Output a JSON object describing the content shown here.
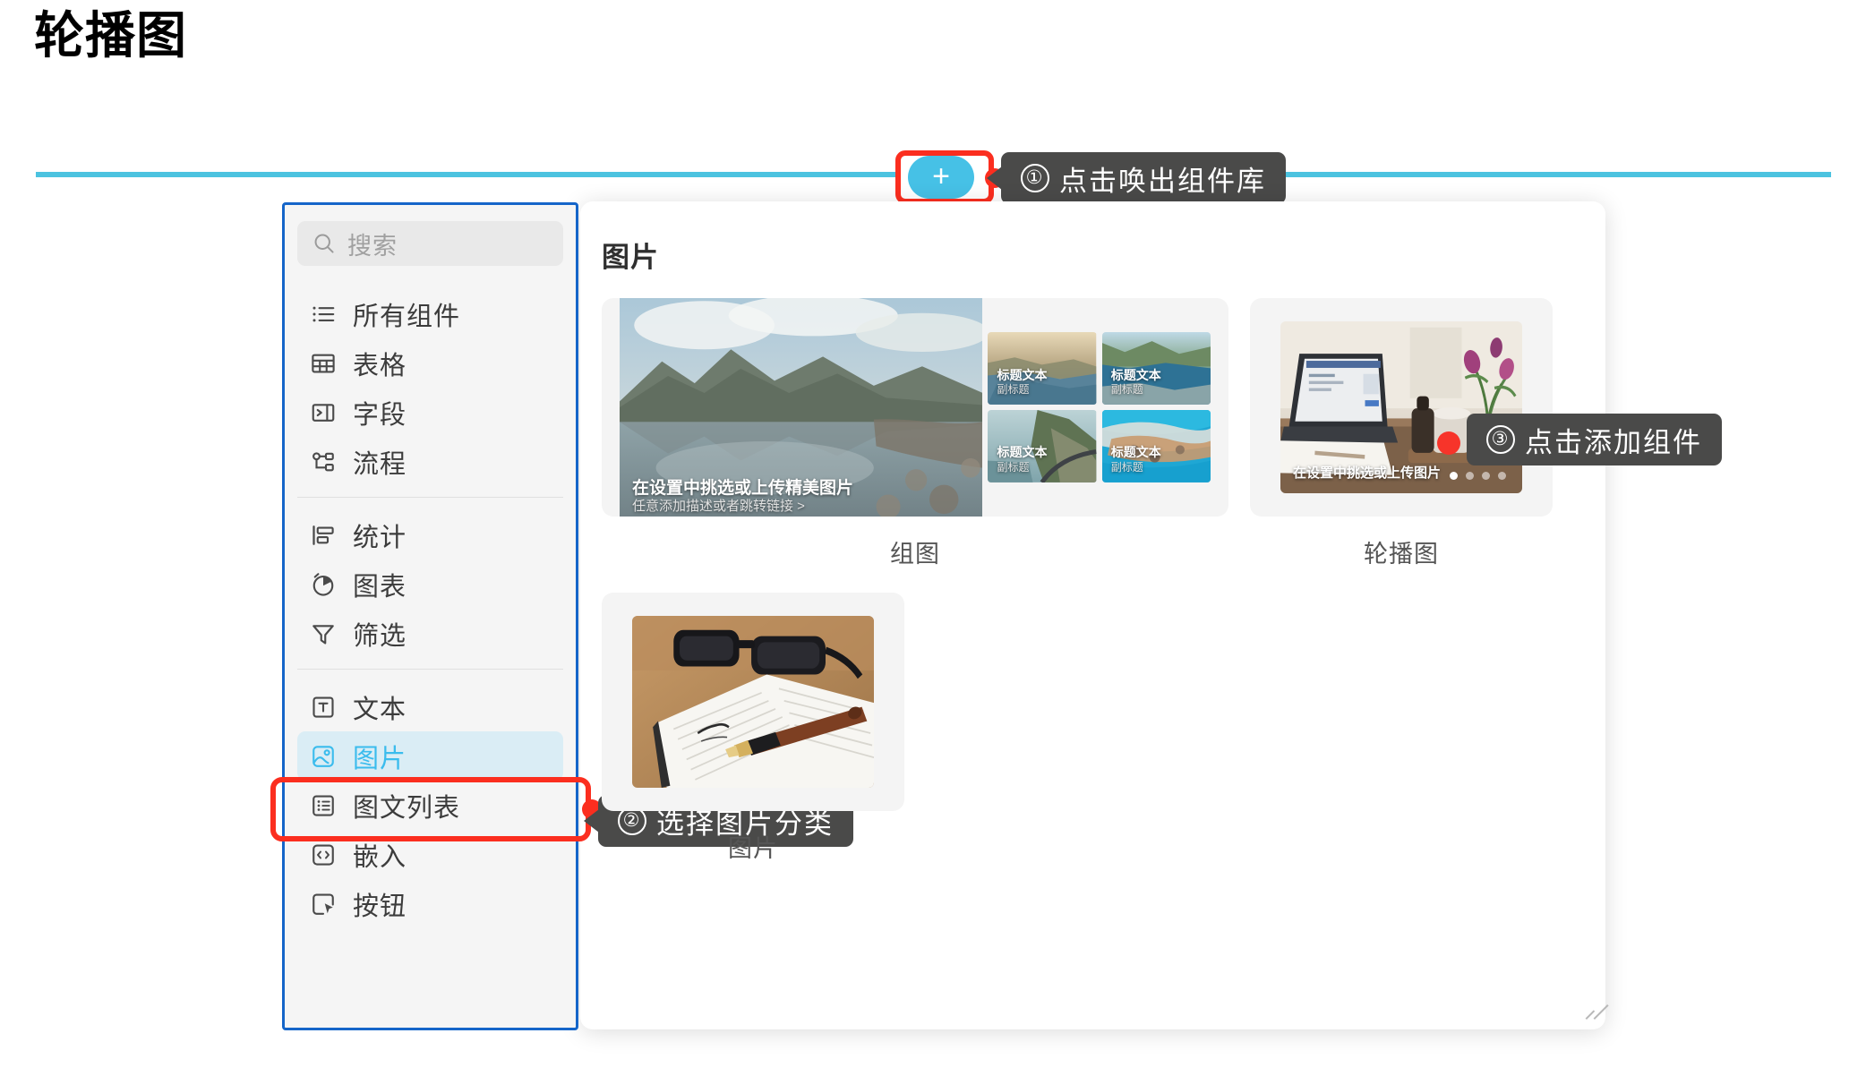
{
  "page": {
    "title": "轮播图"
  },
  "toolbar": {
    "add_button_glyph": "+"
  },
  "callouts": [
    {
      "num": "①",
      "text": "点击唤出组件库"
    },
    {
      "num": "②",
      "text": "选择图片分类"
    },
    {
      "num": "③",
      "text": "点击添加组件"
    }
  ],
  "sidebar": {
    "search": {
      "placeholder": "搜索",
      "value": ""
    },
    "groups": [
      {
        "items": [
          {
            "label": "所有组件",
            "icon": "list-icon",
            "active": false
          },
          {
            "label": "表格",
            "icon": "table-icon",
            "active": false
          },
          {
            "label": "字段",
            "icon": "field-icon",
            "active": false
          },
          {
            "label": "流程",
            "icon": "flow-icon",
            "active": false
          }
        ]
      },
      {
        "items": [
          {
            "label": "统计",
            "icon": "stats-icon",
            "active": false
          },
          {
            "label": "图表",
            "icon": "chart-pie-icon",
            "active": false
          },
          {
            "label": "筛选",
            "icon": "filter-icon",
            "active": false
          }
        ]
      },
      {
        "items": [
          {
            "label": "文本",
            "icon": "text-icon",
            "active": false
          },
          {
            "label": "图片",
            "icon": "image-icon",
            "active": true
          },
          {
            "label": "图文列表",
            "icon": "image-text-list-icon",
            "active": false
          },
          {
            "label": "嵌入",
            "icon": "embed-code-icon",
            "active": false
          },
          {
            "label": "按钮",
            "icon": "button-click-icon",
            "active": false
          }
        ]
      }
    ]
  },
  "library": {
    "section_title": "图片",
    "cards": [
      {
        "caption": "组图",
        "type": "group-image",
        "main_title": "在设置中挑选或上传精美图片",
        "main_subtitle": "任意添加描述或者跳转链接 >",
        "tiles": [
          {
            "title": "标题文本",
            "subtitle": "副标题"
          },
          {
            "title": "标题文本",
            "subtitle": "副标题"
          },
          {
            "title": "标题文本",
            "subtitle": "副标题"
          },
          {
            "title": "标题文本",
            "subtitle": "副标题"
          }
        ]
      },
      {
        "caption": "轮播图",
        "type": "carousel",
        "main_title": "在设置中挑选或上传图片",
        "dots": 4,
        "active_dot": 1
      },
      {
        "caption": "图片",
        "type": "single-image"
      }
    ]
  },
  "colors": {
    "accent_cyan": "#46c1e6",
    "highlight_red": "#fb2e1f",
    "sidebar_border_blue": "#1565c9",
    "active_item_bg": "#daedf5",
    "active_item_text": "#3bbced",
    "callout_bg": "#4a4a49"
  }
}
